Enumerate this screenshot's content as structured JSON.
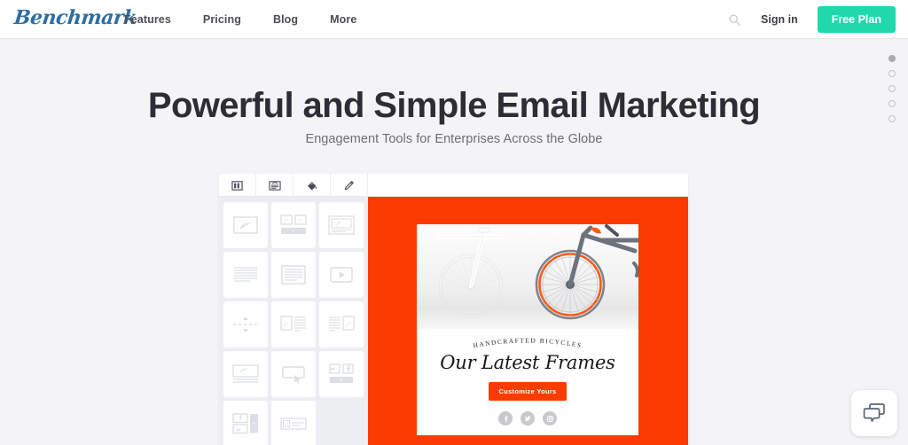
{
  "navbar": {
    "logo": "Benchmark",
    "links": [
      {
        "label": "Features"
      },
      {
        "label": "Pricing"
      },
      {
        "label": "Blog"
      },
      {
        "label": "More"
      }
    ],
    "search_icon": "search-icon",
    "signin_label": "Sign in",
    "cta_label": "Free Plan",
    "cta_color": "#1fd9ad"
  },
  "hero": {
    "title": "Powerful and Simple Email Marketing",
    "subtitle": "Engagement Tools for Enterprises Across the Globe",
    "title_color": "#2d2d35",
    "subtitle_color": "#6e6e78",
    "background": "#f4f4f6"
  },
  "editor": {
    "toolbar": [
      {
        "icon": "columns-layout-icon"
      },
      {
        "icon": "content-block-icon"
      },
      {
        "icon": "paint-bucket-icon"
      },
      {
        "icon": "pencil-icon"
      }
    ],
    "blocks_panel": {
      "background": "#eceef1",
      "tiles": [
        {
          "icon": "image-block-icon"
        },
        {
          "icon": "two-images-button-icon"
        },
        {
          "icon": "image-card-icon"
        },
        {
          "icon": "text-lines-icon"
        },
        {
          "icon": "text-box-icon"
        },
        {
          "icon": "video-block-icon"
        },
        {
          "icon": "spacer-divider-icon"
        },
        {
          "icon": "image-left-text-icon"
        },
        {
          "icon": "text-image-right-icon"
        },
        {
          "icon": "image-caption-icon"
        },
        {
          "icon": "button-cursor-icon"
        },
        {
          "icon": "social-share-icon"
        },
        {
          "icon": "social-follow-icon"
        },
        {
          "icon": "image-text-inline-icon"
        }
      ]
    }
  },
  "email_preview": {
    "background": "#fb3b00",
    "card_background": "#ffffff",
    "photo_alt": "two bicycles against a white wall",
    "eyebrow": "HANDCRAFTED BICYCLES",
    "headline": "Our Latest Frames",
    "cta_label": "Customize Yours",
    "cta_color": "#fb3b00",
    "social": [
      {
        "icon": "facebook-icon"
      },
      {
        "icon": "twitter-icon"
      },
      {
        "icon": "instagram-icon"
      }
    ]
  },
  "slider": {
    "dots": [
      {
        "active": true
      },
      {
        "active": false
      },
      {
        "active": false
      },
      {
        "active": false
      },
      {
        "active": false
      }
    ]
  },
  "chat_widget": {
    "icon": "chat-bubbles-icon"
  }
}
